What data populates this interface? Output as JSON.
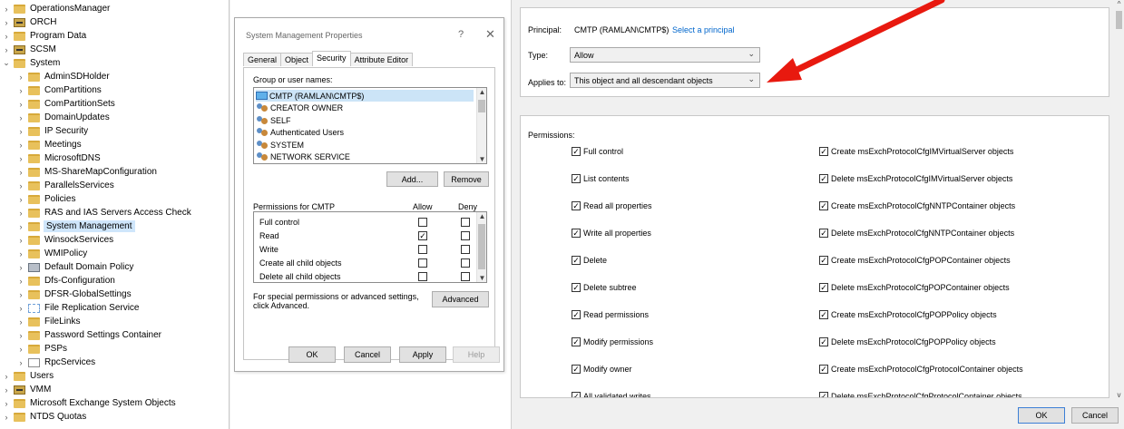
{
  "tree": {
    "items": [
      {
        "label": "OperationsManager",
        "icon": "folder-icon",
        "level": 0,
        "expanded": false
      },
      {
        "label": "ORCH",
        "icon": "server-icon",
        "level": 0,
        "expanded": false
      },
      {
        "label": "Program Data",
        "icon": "folder-icon",
        "level": 0,
        "expanded": false
      },
      {
        "label": "SCSM",
        "icon": "server-icon",
        "level": 0,
        "expanded": false
      },
      {
        "label": "System",
        "icon": "folder-icon",
        "level": 0,
        "expanded": true
      },
      {
        "label": "AdminSDHolder",
        "icon": "folder-icon",
        "level": 1,
        "expanded": false
      },
      {
        "label": "ComPartitions",
        "icon": "folder-icon",
        "level": 1,
        "expanded": false
      },
      {
        "label": "ComPartitionSets",
        "icon": "folder-icon",
        "level": 1,
        "expanded": false
      },
      {
        "label": "DomainUpdates",
        "icon": "folder-icon",
        "level": 1,
        "expanded": false
      },
      {
        "label": "IP Security",
        "icon": "folder-icon",
        "level": 1,
        "expanded": false
      },
      {
        "label": "Meetings",
        "icon": "folder-icon",
        "level": 1,
        "expanded": false
      },
      {
        "label": "MicrosoftDNS",
        "icon": "folder-icon",
        "level": 1,
        "expanded": false
      },
      {
        "label": "MS-ShareMapConfiguration",
        "icon": "folder-icon",
        "level": 1,
        "expanded": false
      },
      {
        "label": "ParallelsServices",
        "icon": "folder-icon",
        "level": 1,
        "expanded": false
      },
      {
        "label": "Policies",
        "icon": "folder-icon",
        "level": 1,
        "expanded": false
      },
      {
        "label": "RAS and IAS Servers Access Check",
        "icon": "folder-icon",
        "level": 1,
        "expanded": false
      },
      {
        "label": "System Management",
        "icon": "folder-icon",
        "level": 1,
        "expanded": false,
        "selected": true
      },
      {
        "label": "WinsockServices",
        "icon": "folder-icon",
        "level": 1,
        "expanded": false
      },
      {
        "label": "WMIPolicy",
        "icon": "folder-icon",
        "level": 1,
        "expanded": false
      },
      {
        "label": "Default Domain Policy",
        "icon": "gpo-icon",
        "level": 1,
        "expanded": false
      },
      {
        "label": "Dfs-Configuration",
        "icon": "folder-icon",
        "level": 1,
        "expanded": false
      },
      {
        "label": "DFSR-GlobalSettings",
        "icon": "folder-icon",
        "level": 1,
        "expanded": false
      },
      {
        "label": "File Replication Service",
        "icon": "replication-icon",
        "level": 1,
        "expanded": false
      },
      {
        "label": "FileLinks",
        "icon": "folder-icon",
        "level": 1,
        "expanded": false
      },
      {
        "label": "Password Settings Container",
        "icon": "folder-icon",
        "level": 1,
        "expanded": false
      },
      {
        "label": "PSPs",
        "icon": "folder-icon",
        "level": 1,
        "expanded": false
      },
      {
        "label": "RpcServices",
        "icon": "rpc-icon",
        "level": 1,
        "expanded": false
      },
      {
        "label": "Users",
        "icon": "folder-icon",
        "level": 0,
        "expanded": false
      },
      {
        "label": "VMM",
        "icon": "server-icon",
        "level": 0,
        "expanded": false
      },
      {
        "label": "Microsoft Exchange System Objects",
        "icon": "folder-icon",
        "level": 0,
        "expanded": false
      },
      {
        "label": "NTDS Quotas",
        "icon": "folder-icon",
        "level": 0,
        "expanded": false
      }
    ]
  },
  "dialog": {
    "title": "System Management Properties",
    "help": "?",
    "close": "✕",
    "tabs": [
      {
        "label": "General",
        "active": false
      },
      {
        "label": "Object",
        "active": false
      },
      {
        "label": "Security",
        "active": true
      },
      {
        "label": "Attribute Editor",
        "active": false
      }
    ],
    "group_label": "Group or user names:",
    "groups": [
      {
        "label": "CMTP (RAMLAN\\CMTP$)",
        "icon": "computer-icon",
        "selected": true
      },
      {
        "label": "CREATOR OWNER",
        "icon": "users-icon"
      },
      {
        "label": "SELF",
        "icon": "users-icon"
      },
      {
        "label": "Authenticated Users",
        "icon": "users-icon"
      },
      {
        "label": "SYSTEM",
        "icon": "users-icon"
      },
      {
        "label": "NETWORK SERVICE",
        "icon": "users-icon"
      }
    ],
    "add_label": "Add...",
    "remove_label": "Remove",
    "perm_header": "Permissions for CMTP",
    "allow_header": "Allow",
    "deny_header": "Deny",
    "permissions": [
      {
        "label": "Full control",
        "allow": false,
        "deny": false
      },
      {
        "label": "Read",
        "allow": true,
        "deny": false
      },
      {
        "label": "Write",
        "allow": false,
        "deny": false
      },
      {
        "label": "Create all child objects",
        "allow": false,
        "deny": false
      },
      {
        "label": "Delete all child objects",
        "allow": false,
        "deny": false
      }
    ],
    "advanced_note": "For special permissions or advanced settings, click Advanced.",
    "advanced_label": "Advanced",
    "ok_label": "OK",
    "cancel_label": "Cancel",
    "apply_label": "Apply",
    "help_label": "Help"
  },
  "advanced": {
    "principal_label": "Principal:",
    "principal_value": "CMTP (RAMLAN\\CMTP$)",
    "select_principal": "Select a principal",
    "type_label": "Type:",
    "type_value": "Allow",
    "applies_label": "Applies to:",
    "applies_value": "This object and all descendant objects",
    "permissions_label": "Permissions:",
    "left_permissions": [
      {
        "label": "Full control",
        "checked": true
      },
      {
        "label": "List contents",
        "checked": true
      },
      {
        "label": "Read all properties",
        "checked": true
      },
      {
        "label": "Write all properties",
        "checked": true
      },
      {
        "label": "Delete",
        "checked": true
      },
      {
        "label": "Delete subtree",
        "checked": true
      },
      {
        "label": "Read permissions",
        "checked": true
      },
      {
        "label": "Modify permissions",
        "checked": true
      },
      {
        "label": "Modify owner",
        "checked": true
      },
      {
        "label": "All validated writes",
        "checked": true
      }
    ],
    "right_permissions": [
      {
        "label": "Create msExchProtocolCfgIMVirtualServer objects",
        "checked": true
      },
      {
        "label": "Delete msExchProtocolCfgIMVirtualServer objects",
        "checked": true
      },
      {
        "label": "Create msExchProtocolCfgNNTPContainer objects",
        "checked": true
      },
      {
        "label": "Delete msExchProtocolCfgNNTPContainer objects",
        "checked": true
      },
      {
        "label": "Create msExchProtocolCfgPOPContainer objects",
        "checked": true
      },
      {
        "label": "Delete msExchProtocolCfgPOPContainer objects",
        "checked": true
      },
      {
        "label": "Create msExchProtocolCfgPOPPolicy objects",
        "checked": true
      },
      {
        "label": "Delete msExchProtocolCfgPOPPolicy objects",
        "checked": true
      },
      {
        "label": "Create msExchProtocolCfgProtocolContainer objects",
        "checked": true
      },
      {
        "label": "Delete msExchProtocolCfgProtocolContainer objects",
        "checked": true
      }
    ],
    "ok_label": "OK",
    "cancel_label": "Cancel"
  },
  "colors": {
    "annotation_arrow": "#e8190f",
    "link": "#0066cc",
    "selection": "#cce4f7"
  }
}
